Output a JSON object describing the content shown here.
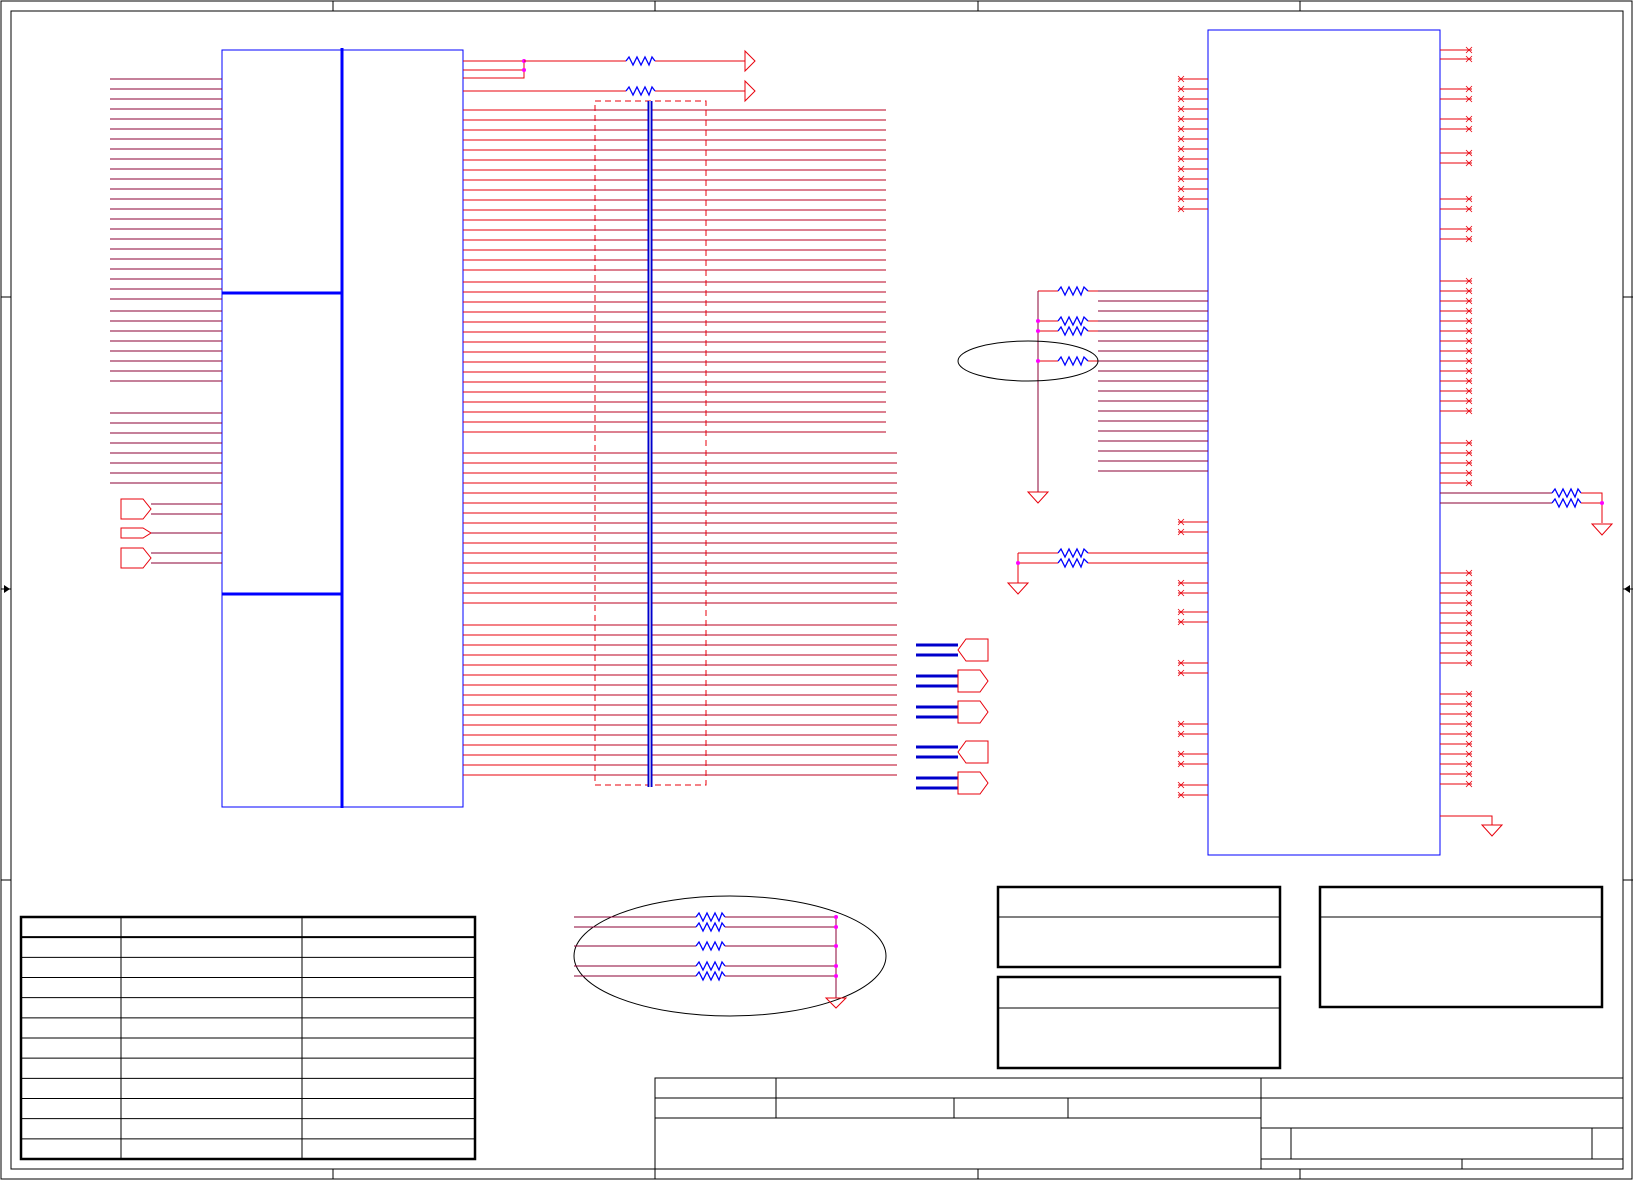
{
  "colors": {
    "wire": "#e8000b",
    "wire_dark": "#8b0035",
    "part": "#0000ff",
    "bus": "#0000cc",
    "resistor": "#0000ff",
    "junction": "#ff00ff",
    "border": "#000000",
    "gnd": "#e8000b"
  },
  "sheet": {
    "zone_columns": 5,
    "zone_rows": 4
  },
  "connector": {
    "sections": 3
  },
  "series_resistors": {
    "count": 2
  },
  "ddr_bus": {
    "groups": 4
  },
  "off_page_connectors": {
    "left_count": 3,
    "right_count": 5
  },
  "right_ic": {
    "no_connect_marks": "x"
  },
  "termination_group": {
    "resistors": 4
  },
  "tables": {
    "revision_rows": 12,
    "revision_columns": 3,
    "note_boxes": 3,
    "title_block": "title-block"
  }
}
